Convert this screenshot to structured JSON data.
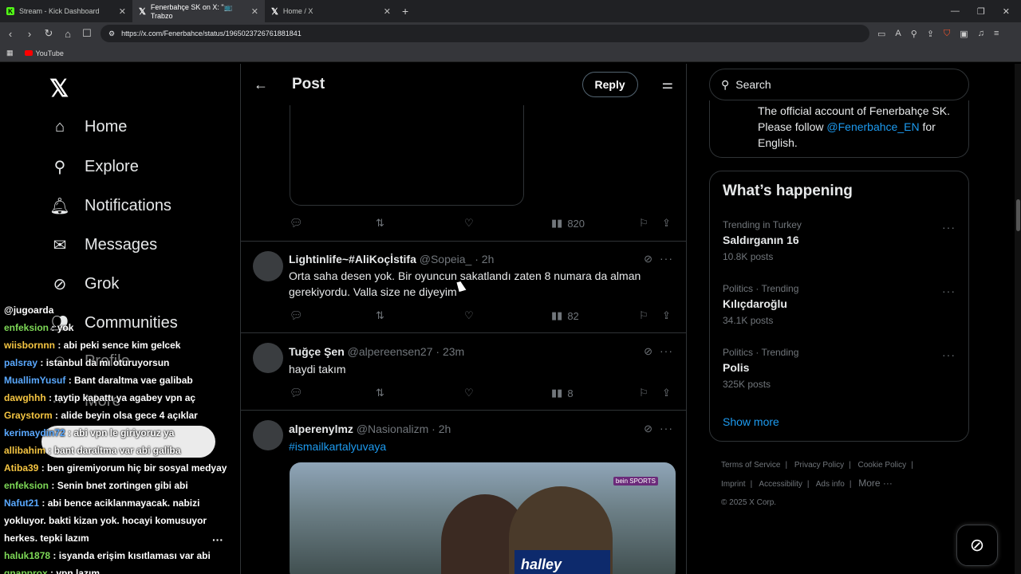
{
  "browser": {
    "tabs": [
      {
        "title": "Stream - Kick Dashboard",
        "icon": "kick-icon"
      },
      {
        "title": "Fenerbahçe SK on X: \"📺 Trabzo",
        "icon": "x-icon",
        "active": true
      },
      {
        "title": "Home / X",
        "icon": "x-icon"
      }
    ],
    "url": "https://x.com/Fenerbahce/status/1965023726761881841",
    "bookmark": "YouTube"
  },
  "nav": {
    "items": [
      "Home",
      "Explore",
      "Notifications",
      "Messages",
      "Grok",
      "Communities",
      "Profile",
      "More"
    ]
  },
  "chat": [
    {
      "user": "@jugoarda",
      "msg": "",
      "color": "#ffffff"
    },
    {
      "user": "enfeksion",
      "msg": ": yok",
      "color": "#7ed957"
    },
    {
      "user": "wiisbornnn",
      "msg": ": abi peki sence kim gelcek",
      "color": "#f5c542"
    },
    {
      "user": "palsray",
      "msg": ": istanbul da mı oturuyorsun",
      "color": "#5aa9ff"
    },
    {
      "user": "MuallimYusuf",
      "msg": ": Bant daraltma vae galibab",
      "color": "#5aa9ff"
    },
    {
      "user": "dawghhh",
      "msg": ": taytip kapattı ya agabey vpn aç",
      "color": "#f5c542"
    },
    {
      "user": "Graystorm",
      "msg": ": alide beyin olsa gece 4 açıklar",
      "color": "#f5c542"
    },
    {
      "user": "kerimaydin72",
      "msg": ": abi vpn le giriyoruz ya",
      "color": "#5aa9ff"
    },
    {
      "user": "allibahim",
      "msg": ": bant daraltma var abi galiba",
      "color": "#f5c542"
    },
    {
      "user": "Atiba39",
      "msg": ": ben giremiyorum hiç bir sosyal medyay",
      "color": "#f5c542"
    },
    {
      "user": "enfeksion",
      "msg": ": Senin bnet zortingen gibi abi",
      "color": "#7ed957"
    },
    {
      "user": "Nafut21",
      "msg": ": abi bence aciklanmayacak. nabizi",
      "color": "#5aa9ff"
    },
    {
      "user": "",
      "msg": "yokluyor. bakti kizan yok. hocayi komusuyor",
      "color": "#ffffff"
    },
    {
      "user": "",
      "msg": "herkes. tepki lazım",
      "color": "#ffffff"
    },
    {
      "user": "haluk1878",
      "msg": ": isyanda erişim kısıtlaması var abi",
      "color": "#7ed957"
    },
    {
      "user": "gnapprox",
      "msg": ": vpn lazım",
      "color": "#7ed957"
    }
  ],
  "post": {
    "header_title": "Post",
    "reply_label": "Reply",
    "main_views": "820"
  },
  "tweets": [
    {
      "name": "Lightinlife~#AliKoçİstifa",
      "handle": "@Sopeia_ · 2h",
      "text": "Orta saha desen yok. Bir oyuncun sakatlandı zaten 8 numara da alman gerekiyordu. Valla size ne diyeyim",
      "views": "82"
    },
    {
      "name": "Tuğçe Şen",
      "handle": "@alpereensen27 · 23m",
      "text": "haydi takım",
      "views": "8"
    },
    {
      "name": "alperenylmz",
      "handle": "@Nasionalizm · 2h",
      "text": "#ismailkartalyuvaya",
      "views": ""
    }
  ],
  "media": {
    "jersey_text": "halley",
    "channel": "bein SPORTS"
  },
  "right": {
    "search_placeholder": "Search",
    "bio_pre": "The official account of Fenerbahçe SK. Please follow ",
    "bio_link": "@Fenerbahce_EN",
    "bio_post": " for English.",
    "happening_title": "What’s happening",
    "trends": [
      {
        "category": "Trending in Turkey",
        "name": "Saldırganın 16",
        "count": "10.8K posts"
      },
      {
        "category": "Politics · Trending",
        "name": "Kılıçdaroğlu",
        "count": "34.1K posts"
      },
      {
        "category": "Politics · Trending",
        "name": "Polis",
        "count": "325K posts"
      }
    ],
    "show_more": "Show more",
    "footer": [
      "Terms of Service",
      "|",
      "Privacy Policy",
      "|",
      "Cookie Policy",
      "|",
      "Imprint",
      "|",
      "Accessibility",
      "|",
      "Ads info",
      "|",
      "More ···",
      "© 2025 X Corp."
    ]
  }
}
